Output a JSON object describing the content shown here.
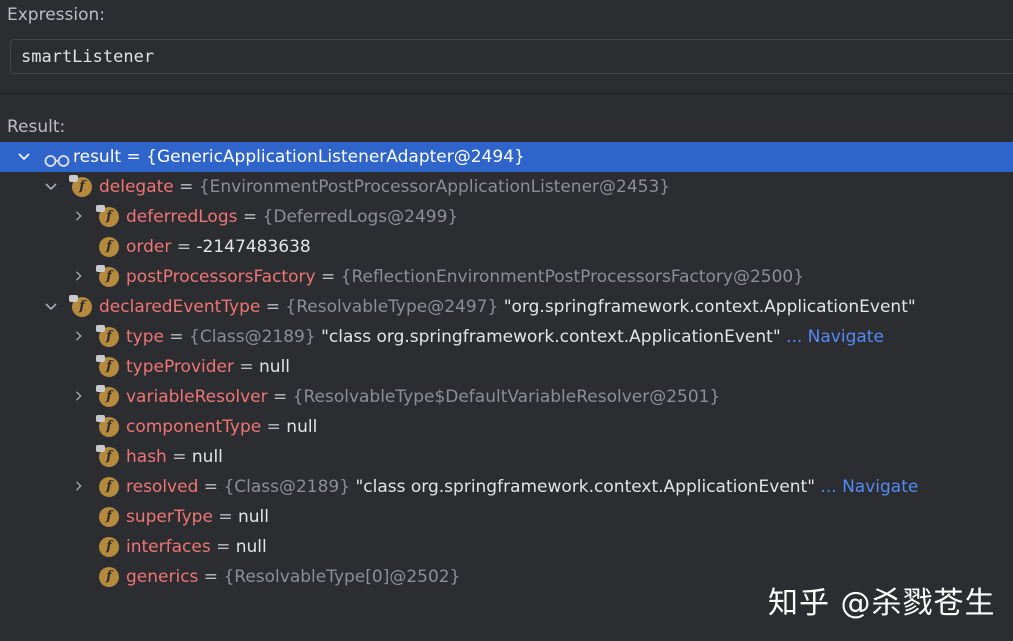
{
  "expression": {
    "label": "Expression:",
    "value": "smartListener"
  },
  "result": {
    "label": "Result:",
    "rows": [
      {
        "name": "result",
        "eq": " = ",
        "type": "{GenericApplicationListenerAdapter@2494}",
        "value": "",
        "link": ""
      },
      {
        "name": "delegate",
        "eq": " = ",
        "type": "{EnvironmentPostProcessorApplicationListener@2453}",
        "value": "",
        "link": ""
      },
      {
        "name": "deferredLogs",
        "eq": " = ",
        "type": "{DeferredLogs@2499}",
        "value": "",
        "link": ""
      },
      {
        "name": "order",
        "eq": " = ",
        "type": "",
        "value": "-2147483638",
        "link": ""
      },
      {
        "name": "postProcessorsFactory",
        "eq": " = ",
        "type": "{ReflectionEnvironmentPostProcessorsFactory@2500}",
        "value": "",
        "link": ""
      },
      {
        "name": "declaredEventType",
        "eq": " = ",
        "type": "{ResolvableType@2497}",
        "value": " \"org.springframework.context.ApplicationEvent\"",
        "link": ""
      },
      {
        "name": "type",
        "eq": " = ",
        "type": "{Class@2189}",
        "value": " \"class org.springframework.context.ApplicationEvent\"",
        "link": " ... Navigate"
      },
      {
        "name": "typeProvider",
        "eq": " = ",
        "type": "",
        "value": "null",
        "link": ""
      },
      {
        "name": "variableResolver",
        "eq": " = ",
        "type": "{ResolvableType$DefaultVariableResolver@2501}",
        "value": "",
        "link": ""
      },
      {
        "name": "componentType",
        "eq": " = ",
        "type": "",
        "value": "null",
        "link": ""
      },
      {
        "name": "hash",
        "eq": " = ",
        "type": "",
        "value": "null",
        "link": ""
      },
      {
        "name": "resolved",
        "eq": " = ",
        "type": "{Class@2189}",
        "value": " \"class org.springframework.context.ApplicationEvent\"",
        "link": " ... Navigate"
      },
      {
        "name": "superType",
        "eq": " = ",
        "type": "",
        "value": "null",
        "link": ""
      },
      {
        "name": "interfaces",
        "eq": " = ",
        "type": "",
        "value": "null",
        "link": ""
      },
      {
        "name": "generics",
        "eq": " = ",
        "type": "{ResolvableType[0]@2502}",
        "value": "",
        "link": ""
      }
    ]
  },
  "watermark": "知乎 @杀戮苍生",
  "colors": {
    "selection": "#2f65ca",
    "field_name": "#f07575",
    "field_icon": "#b58a3c",
    "link": "#548af7",
    "background": "#2b2d30"
  },
  "icons": {
    "result_row": "watch-glasses-icon",
    "field": "field-icon",
    "expander": "chevron-icon"
  }
}
